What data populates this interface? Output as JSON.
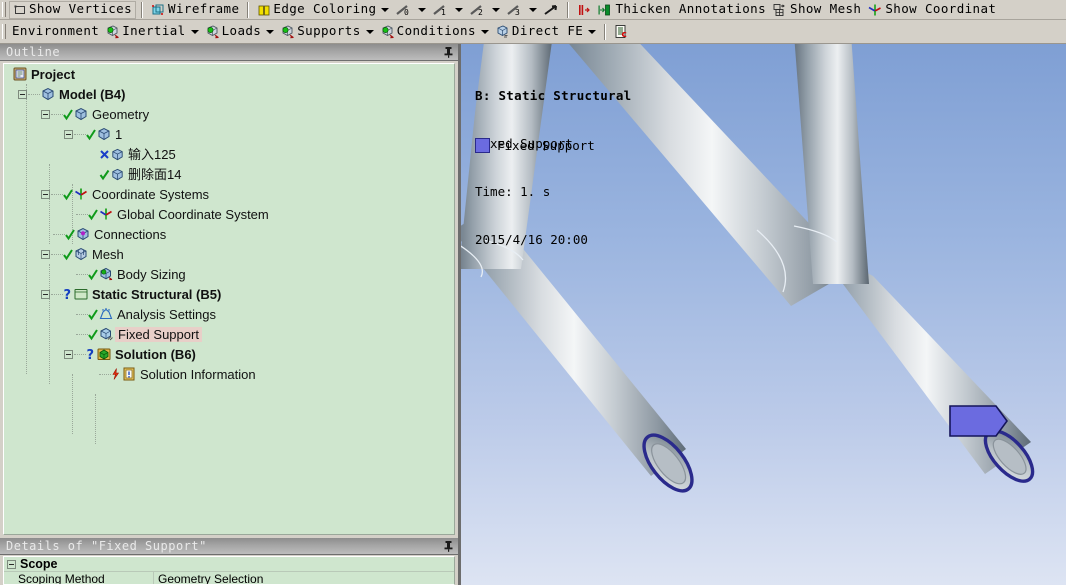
{
  "toolbar_top": {
    "items": [
      {
        "label": "Show Vertices",
        "icon": "vertices-icon",
        "caret": false,
        "boxed": true
      },
      {
        "label": "Wireframe",
        "icon": "wireframe-icon",
        "caret": false,
        "boxed": false
      },
      {
        "label": "Edge Coloring",
        "icon": "edge-coloring-icon",
        "caret": true,
        "boxed": false
      },
      {
        "label": "",
        "icon": "edge-thickness-0-icon",
        "caret": true,
        "boxed": false
      },
      {
        "label": "",
        "icon": "edge-thickness-1-icon",
        "caret": true,
        "boxed": false
      },
      {
        "label": "",
        "icon": "edge-thickness-2-icon",
        "caret": true,
        "boxed": false
      },
      {
        "label": "",
        "icon": "edge-thickness-3-icon",
        "caret": true,
        "boxed": false
      },
      {
        "label": "",
        "icon": "edge-direction-icon",
        "caret": false,
        "boxed": false
      },
      {
        "label": "",
        "icon": "thicken-edges-icon",
        "caret": false,
        "boxed": false
      },
      {
        "label": "Thicken Annotations",
        "icon": "thicken-annotations-icon",
        "caret": false,
        "boxed": false
      },
      {
        "label": "Show Mesh",
        "icon": "show-mesh-icon",
        "caret": false,
        "boxed": false
      },
      {
        "label": "Show Coordinat",
        "icon": "show-coordinate-systems-icon",
        "caret": false,
        "boxed": false
      }
    ]
  },
  "toolbar_env": {
    "items": [
      {
        "label": "Environment",
        "icon": "",
        "caret": false
      },
      {
        "label": "Inertial",
        "icon": "inertial-icon",
        "caret": true
      },
      {
        "label": "Loads",
        "icon": "loads-icon",
        "caret": true
      },
      {
        "label": "Supports",
        "icon": "supports-icon",
        "caret": true
      },
      {
        "label": "Conditions",
        "icon": "conditions-icon",
        "caret": true
      },
      {
        "label": "Direct FE",
        "icon": "direct-fe-icon",
        "caret": true
      }
    ],
    "trailing_icon": "worksheet-icon"
  },
  "outline": {
    "title": "Outline",
    "pin_icon": "pin-icon",
    "nodes": [
      {
        "label": "Project",
        "depth": 0,
        "bold": true,
        "expander": false,
        "icon": "project-icon",
        "status": "none",
        "selected": false
      },
      {
        "label": "Model (B4)",
        "depth": 1,
        "bold": true,
        "expander": true,
        "icon": "model-icon",
        "status": "none",
        "selected": false
      },
      {
        "label": "Geometry",
        "depth": 2,
        "bold": false,
        "expander": true,
        "icon": "geometry-icon",
        "status": "check",
        "selected": false
      },
      {
        "label": "1",
        "depth": 3,
        "bold": false,
        "expander": true,
        "icon": "body-icon",
        "status": "check",
        "selected": false
      },
      {
        "label": "输入125",
        "depth": 4,
        "bold": false,
        "expander": false,
        "icon": "body-icon",
        "status": "cross",
        "selected": false
      },
      {
        "label": "删除面14",
        "depth": 4,
        "bold": false,
        "expander": false,
        "icon": "body-icon",
        "status": "check",
        "selected": false
      },
      {
        "label": "Coordinate Systems",
        "depth": 2,
        "bold": false,
        "expander": true,
        "icon": "coord-sys-icon",
        "status": "check",
        "selected": false
      },
      {
        "label": "Global Coordinate System",
        "depth": 3,
        "bold": false,
        "expander": false,
        "icon": "coord-sys-icon",
        "status": "check",
        "selected": false
      },
      {
        "label": "Connections",
        "depth": 2,
        "bold": false,
        "expander": false,
        "icon": "connections-icon",
        "status": "check",
        "selected": false
      },
      {
        "label": "Mesh",
        "depth": 2,
        "bold": false,
        "expander": true,
        "icon": "mesh-icon",
        "status": "check",
        "selected": false
      },
      {
        "label": "Body Sizing",
        "depth": 3,
        "bold": false,
        "expander": false,
        "icon": "body-sizing-icon",
        "status": "check",
        "selected": false
      },
      {
        "label": "Static Structural (B5)",
        "depth": 2,
        "bold": true,
        "expander": true,
        "icon": "analysis-icon",
        "status": "question",
        "selected": false
      },
      {
        "label": "Analysis Settings",
        "depth": 3,
        "bold": false,
        "expander": false,
        "icon": "analysis-settings-icon",
        "status": "check",
        "selected": false
      },
      {
        "label": "Fixed Support",
        "depth": 3,
        "bold": false,
        "expander": false,
        "icon": "fixed-support-icon",
        "status": "check",
        "selected": true
      },
      {
        "label": "Solution (B6)",
        "depth": 3,
        "bold": true,
        "expander": true,
        "icon": "solution-icon",
        "status": "question",
        "selected": false
      },
      {
        "label": "Solution Information",
        "depth": 4,
        "bold": false,
        "expander": false,
        "icon": "solution-info-icon",
        "status": "lightning",
        "selected": false
      }
    ]
  },
  "details": {
    "title": "Details of \"Fixed Support\"",
    "pin_icon": "pin-icon",
    "group_label": "Scope",
    "rows": [
      {
        "key": "Scoping Method",
        "value": "Geometry Selection"
      }
    ]
  },
  "viewport": {
    "legend_title": "B: Static Structural",
    "legend_line2": "Fixed Support",
    "legend_line3": "Time: 1. s",
    "legend_line4": "2015/4/16 20:00",
    "legend_entry_label": "Fixed Support",
    "legend_swatch_color": "#6b6be0",
    "support_marker_color": "#6b6be0",
    "support_outline_color": "#2a2a8c"
  }
}
